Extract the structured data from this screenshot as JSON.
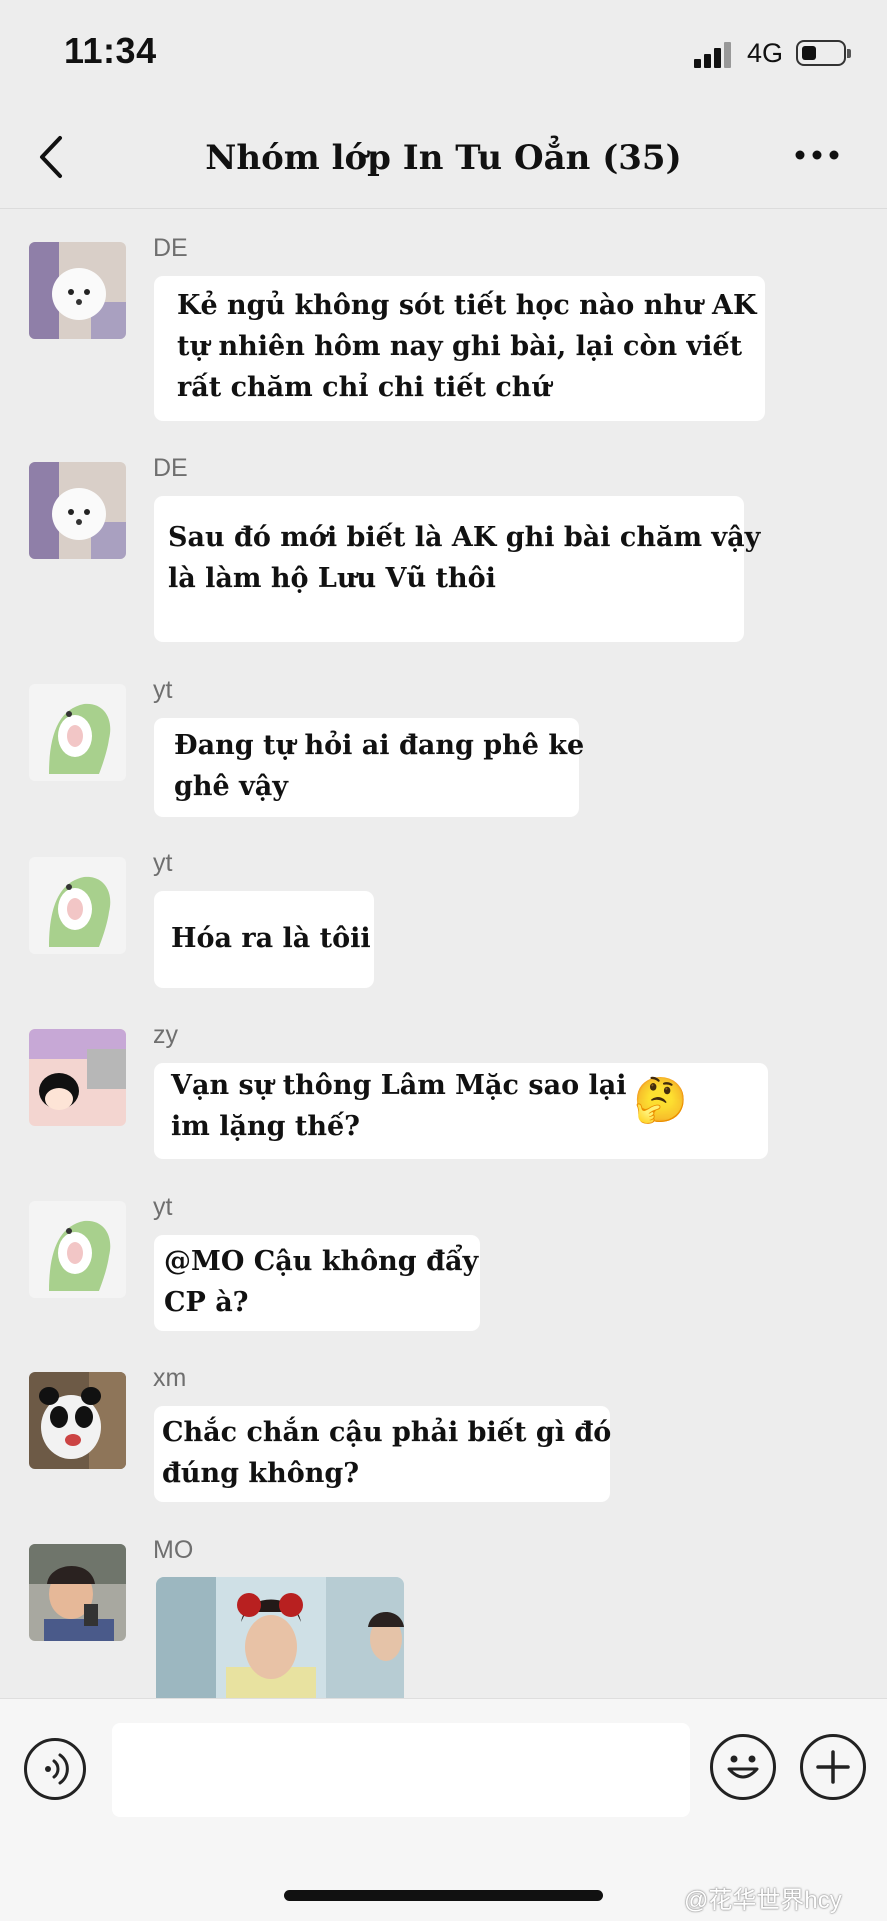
{
  "status_bar": {
    "time": "11:34",
    "network": "4G",
    "battery_level": 0.3
  },
  "header": {
    "title": "Nhóm lớp In Tu Oẳn (35)",
    "back_icon": "chevron-left-icon",
    "more_icon": "more-icon"
  },
  "messages": [
    {
      "sender": "DE",
      "lines": [
        "Kẻ ngủ không sót tiết học nào như AK",
        "tự nhiên hôm nay ghi bài, lại còn viết",
        "rất chăm chỉ chi tiết chứ"
      ]
    },
    {
      "sender": "DE",
      "lines": [
        "Sau đó mới biết là AK ghi bài chăm vậy",
        "là làm hộ Lưu Vũ thôi"
      ]
    },
    {
      "sender": "yt",
      "lines": [
        "Đang tự hỏi ai đang phê ke",
        "ghê vậy"
      ]
    },
    {
      "sender": "yt",
      "lines": [
        "Hóa ra là tôii"
      ]
    },
    {
      "sender": "zy",
      "lines": [
        "Vạn sự thông Lâm Mặc sao lại",
        "im lặng thế?"
      ],
      "emoji": "🤔"
    },
    {
      "sender": "yt",
      "lines": [
        "@MO Cậu không đẩy",
        "CP à?"
      ]
    },
    {
      "sender": "xm",
      "lines": [
        "Chắc chắn cậu phải biết gì đó",
        "đúng không?"
      ]
    },
    {
      "sender": "MO",
      "type": "image"
    }
  ],
  "input_bar": {
    "placeholder": "",
    "voice_icon": "voice-icon",
    "emoji_icon": "emoji-icon",
    "plus_icon": "plus-icon"
  },
  "watermark": "@花华世界hcy"
}
